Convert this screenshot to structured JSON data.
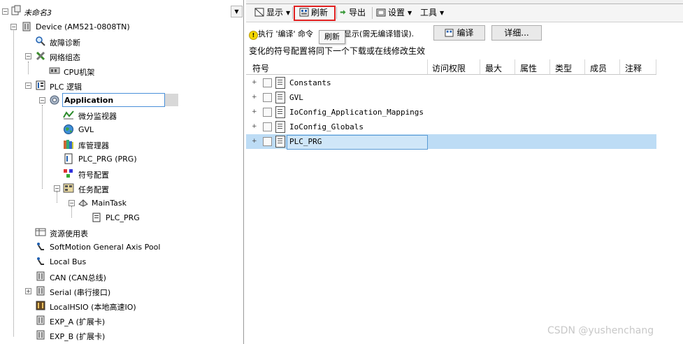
{
  "project_tree": {
    "title": "未命名3",
    "items": [
      {
        "label": "Device (AM521-0808TN)",
        "icon": "device-icon"
      },
      {
        "label": "故障诊断",
        "icon": "magnifier-icon"
      },
      {
        "label": "网络组态",
        "icon": "network-icon"
      },
      {
        "label": "CPU机架",
        "icon": "rack-icon"
      },
      {
        "label": "PLC 逻辑",
        "icon": "plc-logic-icon"
      },
      {
        "label": "Application",
        "icon": "application-gear-icon"
      },
      {
        "label": "微分监视器",
        "icon": "trace-icon"
      },
      {
        "label": "GVL",
        "icon": "globe-icon"
      },
      {
        "label": "库管理器",
        "icon": "books-icon"
      },
      {
        "label": "PLC_PRG (PRG)",
        "icon": "pou-icon"
      },
      {
        "label": "符号配置",
        "icon": "symbol-config-icon"
      },
      {
        "label": "任务配置",
        "icon": "task-config-icon"
      },
      {
        "label": "MainTask",
        "icon": "task-icon"
      },
      {
        "label": "PLC_PRG",
        "icon": "program-call-icon"
      },
      {
        "label": "资源使用表",
        "icon": "table-icon"
      },
      {
        "label": "SoftMotion General Axis Pool",
        "icon": "axis-icon"
      },
      {
        "label": "Local Bus",
        "icon": "bus-icon"
      },
      {
        "label": "CAN (CAN总线)",
        "icon": "device-icon"
      },
      {
        "label": "Serial (串行接口)",
        "icon": "device-icon"
      },
      {
        "label": "LocalHSIO (本地高速IO)",
        "icon": "io-icon"
      },
      {
        "label": "EXP_A (扩展卡)",
        "icon": "device-icon"
      },
      {
        "label": "EXP_B (扩展卡)",
        "icon": "device-icon"
      }
    ]
  },
  "toolbar": {
    "view_label": "显示",
    "refresh_label": "刷新",
    "export_label": "导出",
    "settings_label": "设置",
    "tools_label": "工具",
    "highlight_color": "#e02020"
  },
  "info": {
    "message_prefix": "执行 '编译' 命令",
    "message_suffix": "显示(需无编译错误).",
    "tooltip": "刷新",
    "compile_button": "编译",
    "details_button": "详细...",
    "note": "变化的符号配置将同下一个下载或在线修改生效"
  },
  "grid": {
    "columns": [
      "符号",
      "访问权限",
      "最大",
      "属性",
      "类型",
      "成员",
      "注释"
    ],
    "rows": [
      {
        "name": "Constants"
      },
      {
        "name": "GVL"
      },
      {
        "name": "IoConfig_Application_Mappings"
      },
      {
        "name": "IoConfig_Globals"
      },
      {
        "name": "PLC_PRG"
      }
    ],
    "selection_color": "#bddcf5"
  },
  "watermark": "CSDN @yushenchang"
}
